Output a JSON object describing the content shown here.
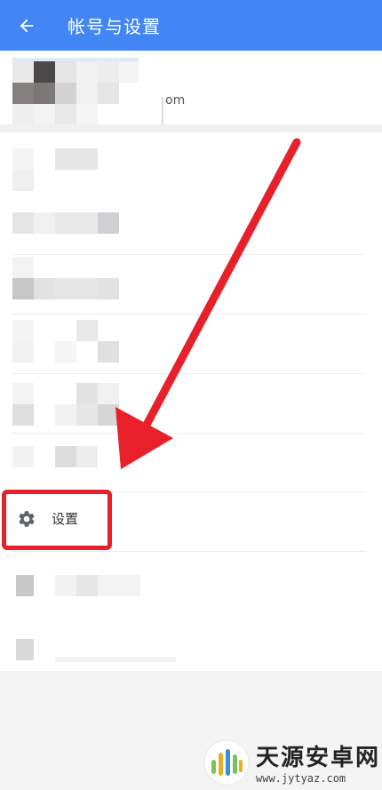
{
  "appbar": {
    "title": "帐号与设置",
    "back_icon": "arrow-left-icon",
    "bg_color": "#4285f4"
  },
  "account": {
    "email_fragment": "om"
  },
  "settings_item": {
    "label": "设置",
    "icon": "gear-icon"
  },
  "annotation": {
    "highlight_color": "#e8202a"
  },
  "watermark": {
    "brand_cn": "天源安卓网",
    "brand_en": "www.jytyaz.com"
  }
}
